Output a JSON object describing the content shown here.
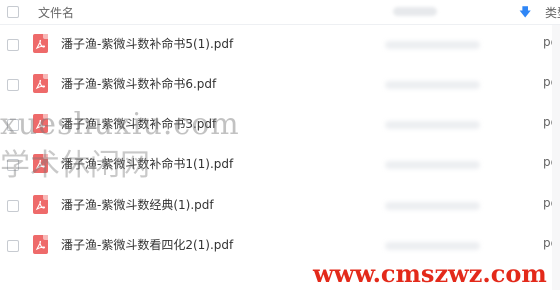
{
  "header": {
    "name_label": "文件名",
    "type_label": "类型"
  },
  "files": [
    {
      "name": "潘子渔-紫微斗数补命书5(1).pdf",
      "type": "pdf"
    },
    {
      "name": "潘子渔-紫微斗数补命书6.pdf",
      "type": "pdf"
    },
    {
      "name": "潘子渔-紫微斗数补命书3.pdf",
      "type": "pdf"
    },
    {
      "name": "潘子渔-紫微斗数补命书1(1).pdf",
      "type": "pdf"
    },
    {
      "name": "潘子渔-紫微斗数经典(1).pdf",
      "type": "pdf"
    },
    {
      "name": "潘子渔-紫微斗数看四化2(1).pdf",
      "type": "pdf"
    }
  ],
  "watermarks": {
    "latin": "xueshuxiu.com",
    "cjk": "学术休闲网",
    "site": "www.cmszwz.com"
  },
  "icons": {
    "sort": "sort-down-arrow-icon",
    "file": "pdf-file-icon"
  },
  "colors": {
    "accent": "#2f86f6",
    "pdf_icon": "#ee6a6a",
    "watermark_red": "#e3291a"
  }
}
